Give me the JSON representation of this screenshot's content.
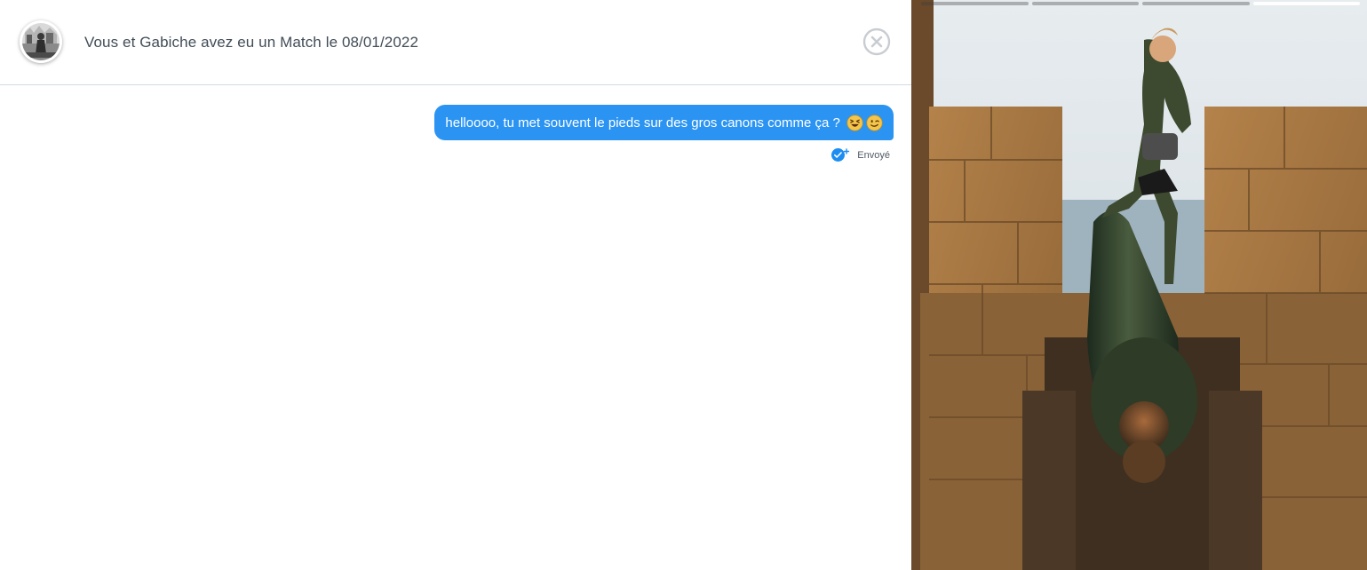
{
  "header": {
    "avatar_alt": "avatar",
    "match_title": "Vous et Gabiche avez eu un Match le 08/01/2022",
    "close_icon": "close-circle-icon"
  },
  "messages": [
    {
      "text": "helloooo, tu met souvent le pieds sur des gros canons comme ça ? ",
      "emojis": [
        "laughing-squint-emoji",
        "wink-emoji"
      ],
      "status": "Envoyé",
      "status_icon": "sent-check-icon"
    }
  ],
  "colors": {
    "bubble": "#2b94f3",
    "header_text": "#424d57",
    "divider": "#d4d8de",
    "status_icon": "#1c8df2"
  },
  "photo": {
    "indicator_count": 4,
    "active_indicator": 4
  }
}
